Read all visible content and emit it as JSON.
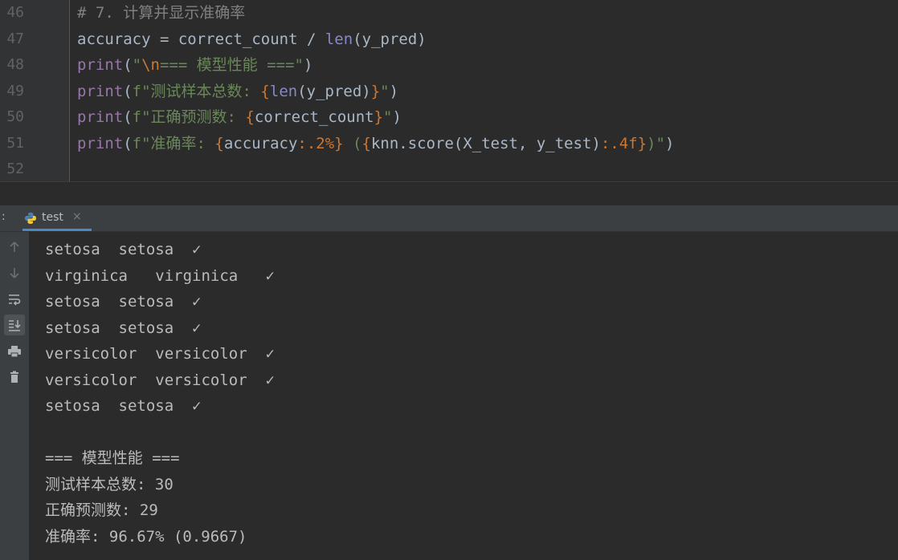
{
  "editor": {
    "lines": [
      {
        "number": "46",
        "segments": [
          {
            "cls": "cmt",
            "text": "# 7. 计算并显示准确率"
          }
        ]
      },
      {
        "number": "47",
        "segments": [
          {
            "cls": "plain",
            "text": "accuracy = correct_count / "
          },
          {
            "cls": "fn",
            "text": "len"
          },
          {
            "cls": "plain",
            "text": "(y_pred)"
          }
        ]
      },
      {
        "number": "48",
        "segments": [
          {
            "cls": "kw",
            "text": "print"
          },
          {
            "cls": "plain",
            "text": "("
          },
          {
            "cls": "str",
            "text": "\""
          },
          {
            "cls": "esc",
            "text": "\\n"
          },
          {
            "cls": "str",
            "text": "=== 模型性能 ===\""
          },
          {
            "cls": "plain",
            "text": ")"
          }
        ]
      },
      {
        "number": "49",
        "segments": [
          {
            "cls": "kw",
            "text": "print"
          },
          {
            "cls": "plain",
            "text": "("
          },
          {
            "cls": "str",
            "text": "f\"测试样本总数: "
          },
          {
            "cls": "brace",
            "text": "{"
          },
          {
            "cls": "fn",
            "text": "len"
          },
          {
            "cls": "plain",
            "text": "(y_pred)"
          },
          {
            "cls": "brace",
            "text": "}"
          },
          {
            "cls": "str",
            "text": "\""
          },
          {
            "cls": "plain",
            "text": ")"
          }
        ]
      },
      {
        "number": "50",
        "segments": [
          {
            "cls": "kw",
            "text": "print"
          },
          {
            "cls": "plain",
            "text": "("
          },
          {
            "cls": "str",
            "text": "f\"正确预测数: "
          },
          {
            "cls": "brace",
            "text": "{"
          },
          {
            "cls": "plain",
            "text": "correct_count"
          },
          {
            "cls": "brace",
            "text": "}"
          },
          {
            "cls": "str",
            "text": "\""
          },
          {
            "cls": "plain",
            "text": ")"
          }
        ]
      },
      {
        "number": "51",
        "segments": [
          {
            "cls": "kw",
            "text": "print"
          },
          {
            "cls": "plain",
            "text": "("
          },
          {
            "cls": "str",
            "text": "f\"准确率: "
          },
          {
            "cls": "brace",
            "text": "{"
          },
          {
            "cls": "plain",
            "text": "accuracy"
          },
          {
            "cls": "fmt",
            "text": ":.2%"
          },
          {
            "cls": "brace",
            "text": "}"
          },
          {
            "cls": "str",
            "text": " ("
          },
          {
            "cls": "brace",
            "text": "{"
          },
          {
            "cls": "plain",
            "text": "knn.score(X_test, y_test)"
          },
          {
            "cls": "fmt",
            "text": ":.4f"
          },
          {
            "cls": "brace",
            "text": "}"
          },
          {
            "cls": "str",
            "text": ")\""
          },
          {
            "cls": "plain",
            "text": ")"
          }
        ]
      },
      {
        "number": "52",
        "segments": []
      }
    ]
  },
  "run_panel": {
    "colon": ":",
    "tab_label": "test",
    "tab_close": "×"
  },
  "toolbar": {
    "icons": [
      "arrow-up-icon",
      "arrow-down-icon",
      "soft-wrap-icon",
      "scroll-to-end-icon",
      "print-icon",
      "trash-icon"
    ]
  },
  "console": {
    "lines": [
      "setosa  setosa  ✓",
      "virginica   virginica   ✓",
      "setosa  setosa  ✓",
      "setosa  setosa  ✓",
      "versicolor  versicolor  ✓",
      "versicolor  versicolor  ✓",
      "setosa  setosa  ✓",
      "",
      "=== 模型性能 ===",
      "测试样本总数: 30",
      "正确预测数: 29",
      "准确率: 96.67% (0.9667)"
    ]
  }
}
